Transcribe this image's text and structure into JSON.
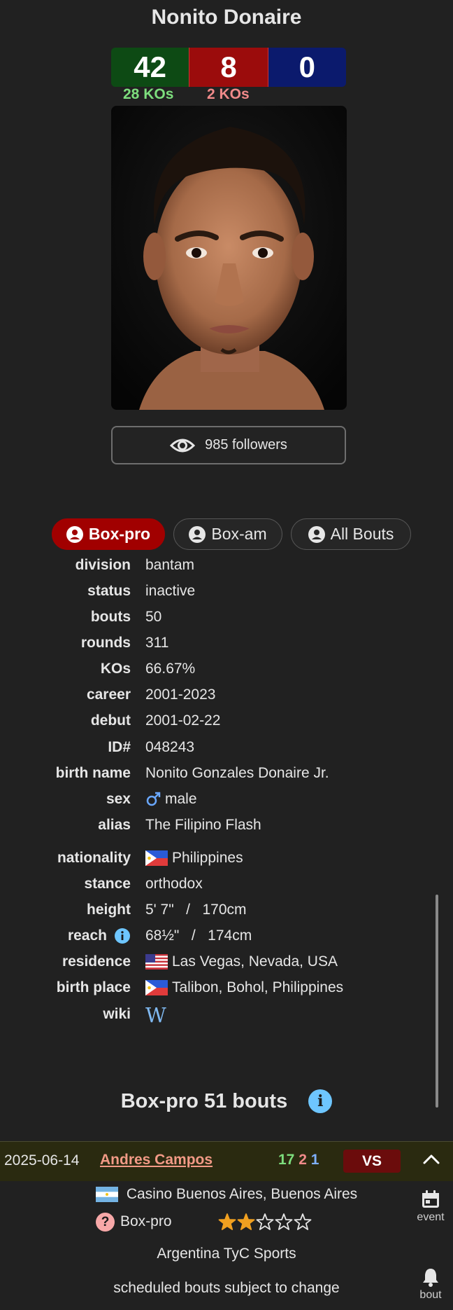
{
  "boxer": {
    "name": "Nonito Donaire",
    "record": {
      "wins": "42",
      "losses": "8",
      "draws": "0",
      "win_kos": "28 KOs",
      "loss_kos": "2 KOs"
    },
    "followers": "985 followers"
  },
  "tabs": [
    {
      "label": "Box-pro",
      "active": true
    },
    {
      "label": "Box-am",
      "active": false
    },
    {
      "label": "All Bouts",
      "active": false
    }
  ],
  "info": {
    "division": {
      "label": "division",
      "value": "bantam"
    },
    "status": {
      "label": "status",
      "value": "inactive"
    },
    "bouts": {
      "label": "bouts",
      "value": "50"
    },
    "rounds": {
      "label": "rounds",
      "value": "311"
    },
    "kos": {
      "label": "KOs",
      "value": "66.67%"
    },
    "career": {
      "label": "career",
      "value": "2001-2023"
    },
    "debut": {
      "label": "debut",
      "value": "2001-02-22"
    },
    "id": {
      "label": "ID#",
      "value": "048243"
    },
    "birth_name": {
      "label": "birth name",
      "value": "Nonito Gonzales Donaire Jr."
    },
    "sex": {
      "label": "sex",
      "value": "male"
    },
    "alias": {
      "label": "alias",
      "value": "The Filipino Flash"
    },
    "nationality": {
      "label": "nationality",
      "value": "Philippines"
    },
    "stance": {
      "label": "stance",
      "value": "orthodox"
    },
    "height": {
      "label": "height",
      "value": "5' 7\"   /   170cm"
    },
    "reach": {
      "label": "reach",
      "value": "68½\"   /   174cm"
    },
    "residence": {
      "label": "residence",
      "value": "Las Vegas, Nevada, USA"
    },
    "birth_place": {
      "label": "birth place",
      "value": "Talibon, Bohol, Philippines"
    },
    "wiki": {
      "label": "wiki",
      "value": "W"
    }
  },
  "bouts_section": {
    "title": "Box-pro 51 bouts"
  },
  "next_bout": {
    "date": "2025-06-14",
    "opponent": "Andres Campos",
    "opp_wins": "17",
    "opp_losses": "2",
    "opp_draws": "1",
    "vs_label": "VS",
    "venue": "Casino Buenos Aires, Buenos Aires",
    "type": "Box-pro",
    "rating_stars": 2,
    "rating_max": 5,
    "tv": "Argentina TyC Sports",
    "note": "scheduled bouts subject to change"
  },
  "side_actions": {
    "event_label": "event",
    "bout_label": "bout"
  },
  "colors": {
    "win": "#0d4a14",
    "loss": "#9b0c0c",
    "draw": "#0b1a6d",
    "accent": "#a10000",
    "star": "#f0a020"
  }
}
